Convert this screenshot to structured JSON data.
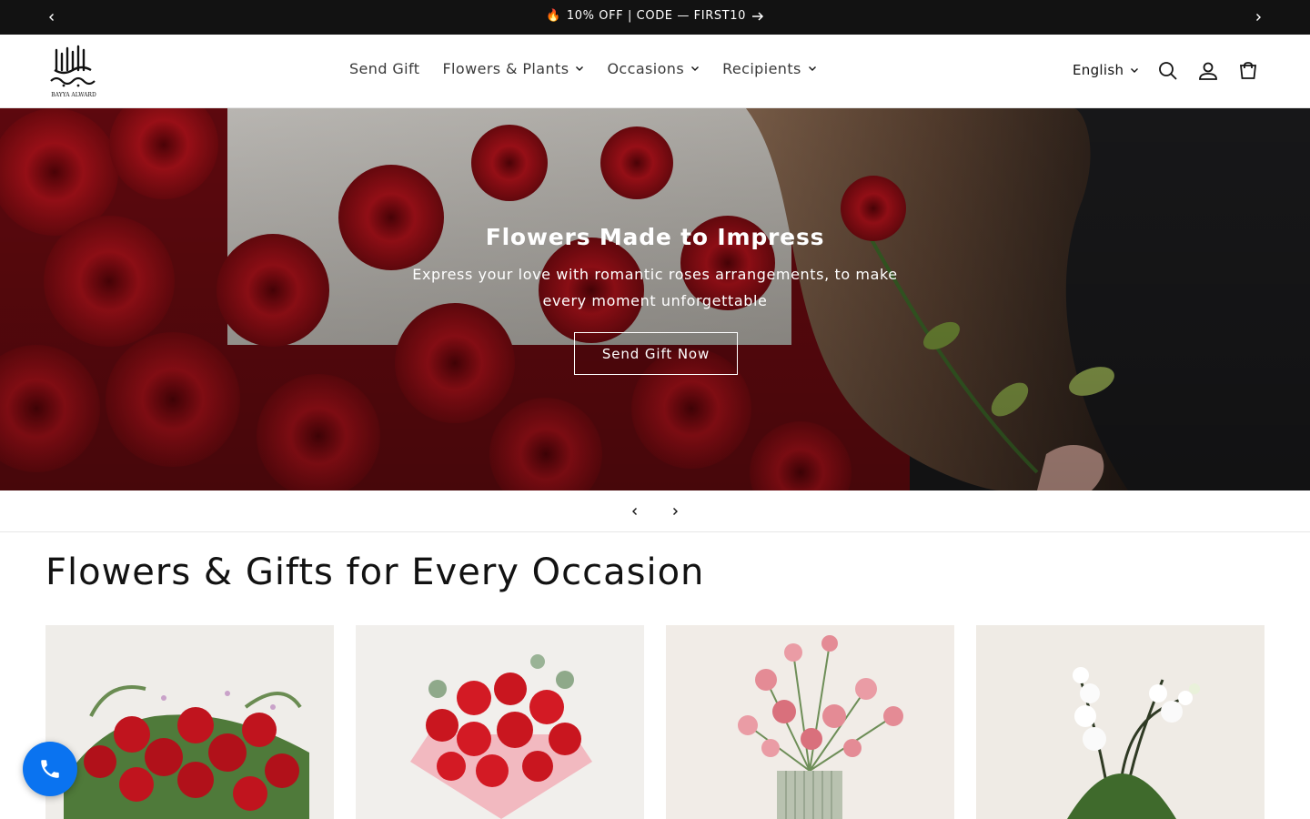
{
  "announcement": {
    "icon": "fire-icon",
    "text": "10% OFF | CODE — FIRST10",
    "prev_icon": "chevron-left-icon",
    "next_icon": "chevron-right-icon"
  },
  "header": {
    "logo_text": "BAYYA ALWARD",
    "nav": [
      {
        "label": "Send Gift",
        "has_dropdown": false
      },
      {
        "label": "Flowers & Plants",
        "has_dropdown": true
      },
      {
        "label": "Occasions",
        "has_dropdown": true
      },
      {
        "label": "Recipients",
        "has_dropdown": true
      }
    ],
    "language": "English",
    "icons": [
      "search-icon",
      "account-icon",
      "cart-icon"
    ]
  },
  "hero": {
    "title": "Flowers Made to Impress",
    "subtitle": "Express your love with romantic roses arrangements, to make every moment unforgettable",
    "cta": "Send Gift Now"
  },
  "collections": {
    "title": "Flowers & Gifts for Every Occasion"
  },
  "colors": {
    "announcement_bg": "#121212",
    "call_button": "#0a73f0",
    "rose_red": "#b5121b"
  }
}
